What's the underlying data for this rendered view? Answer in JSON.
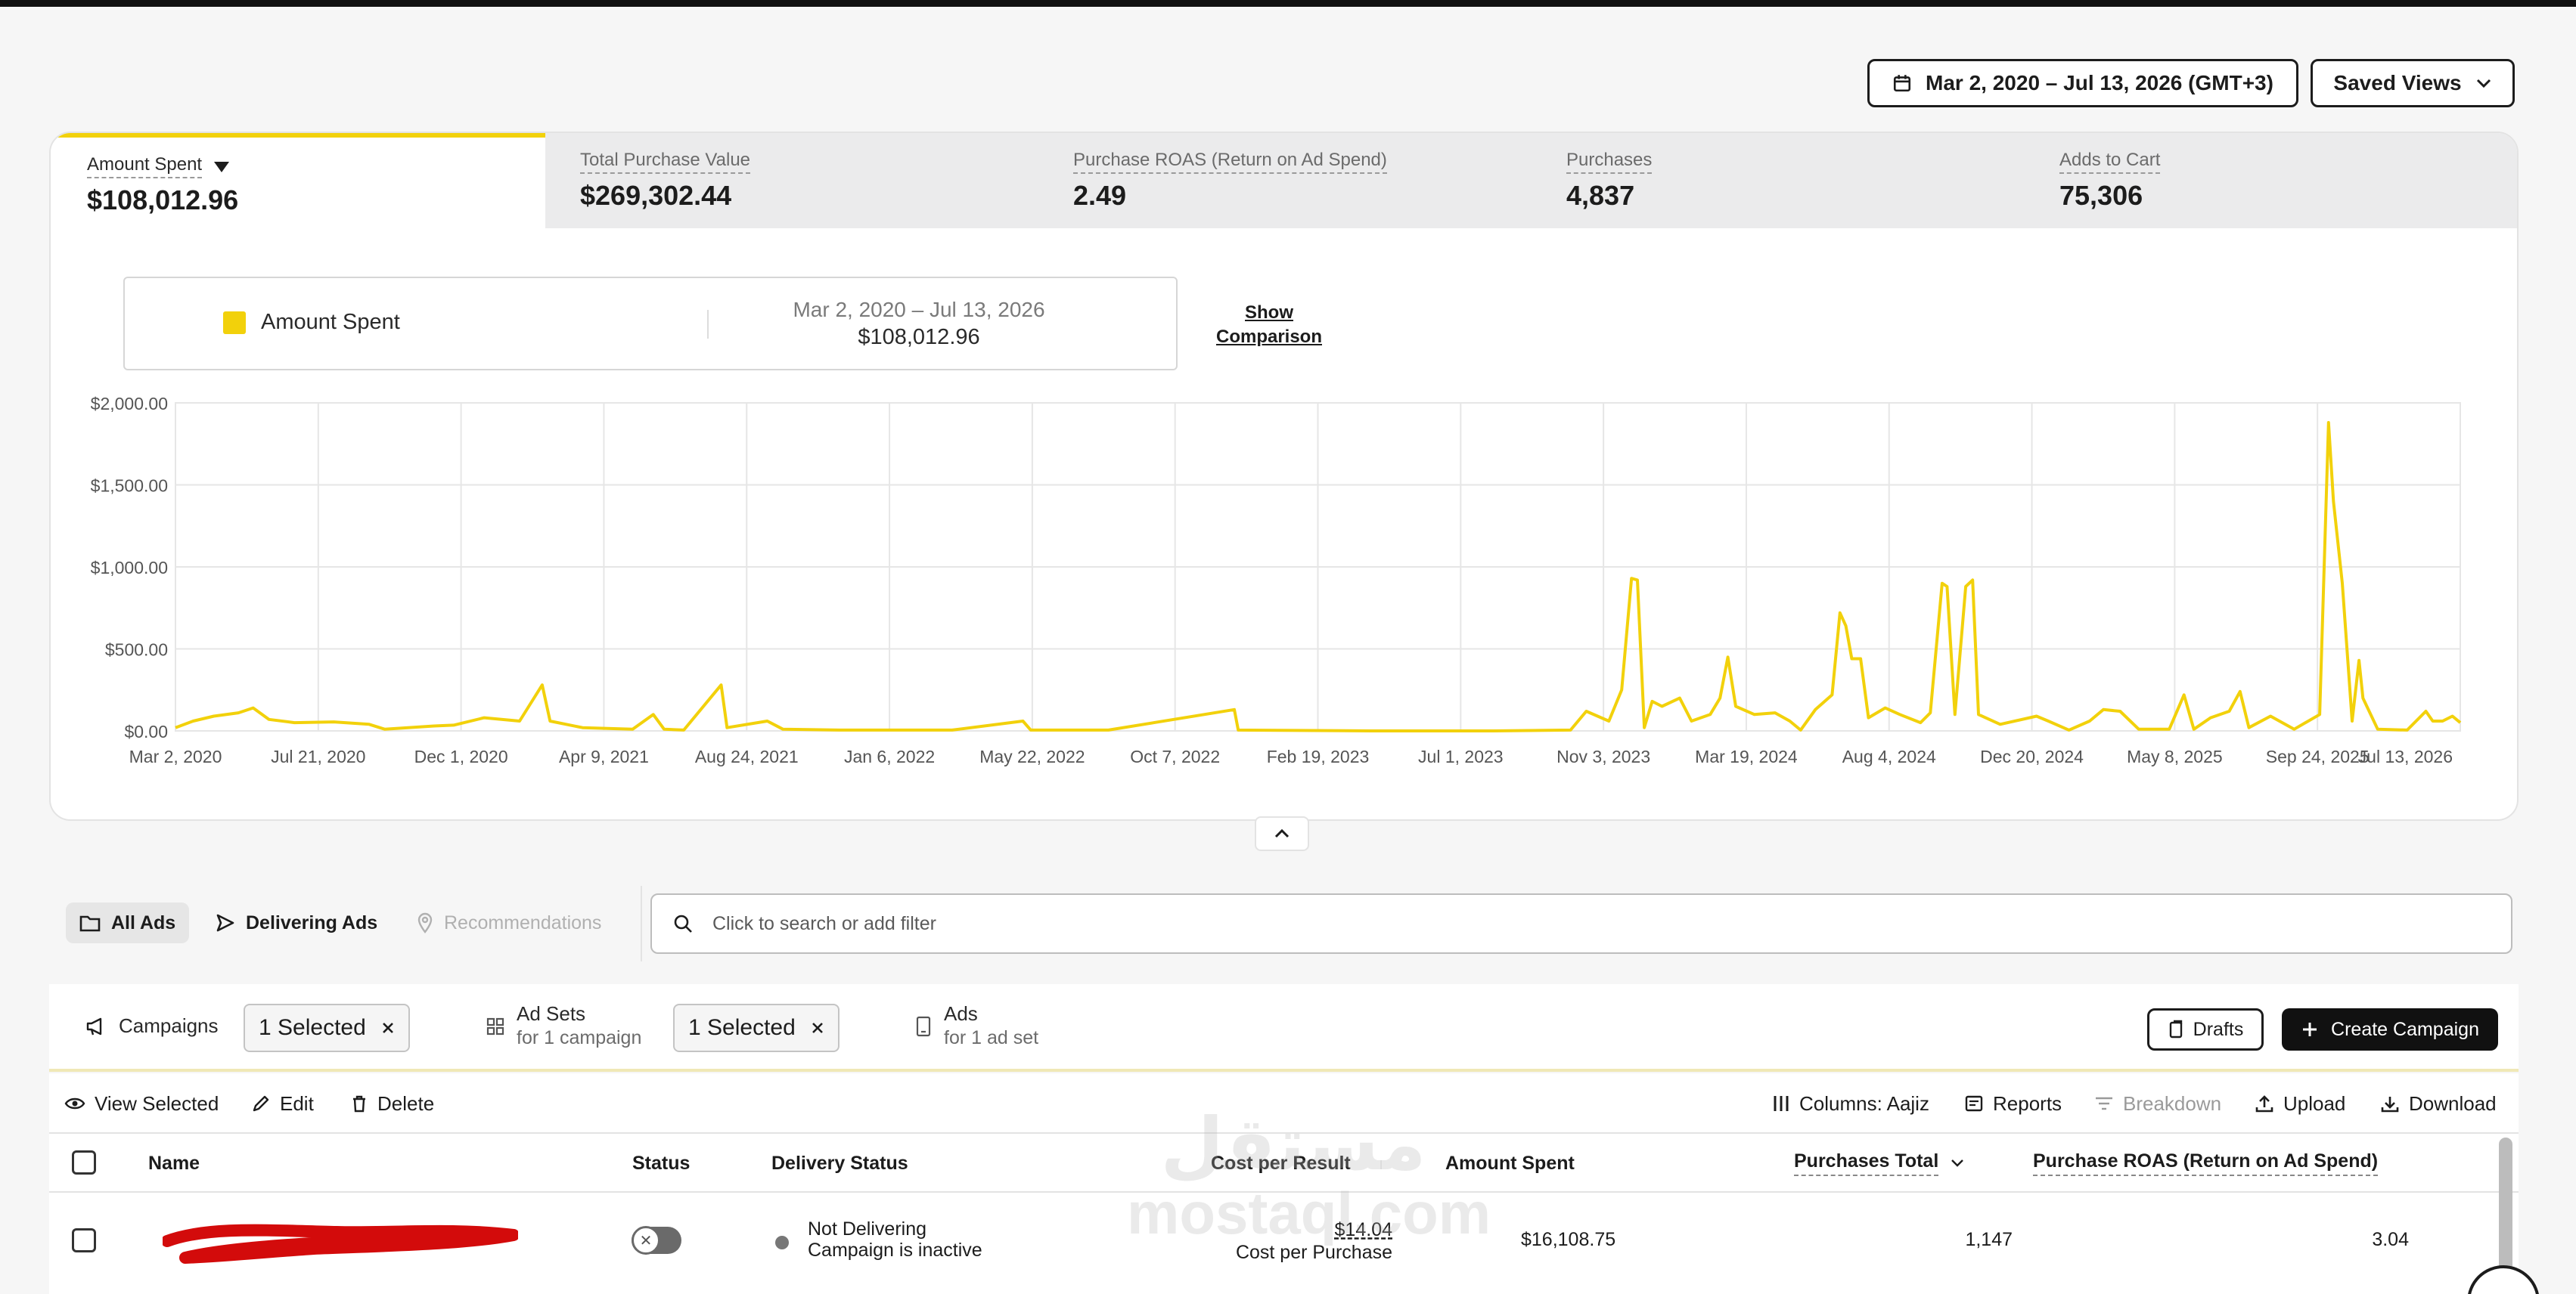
{
  "header": {
    "date_range": "Mar 2, 2020 – Jul 13, 2026 (GMT+3)",
    "saved_views": "Saved Views"
  },
  "metrics": [
    {
      "label": "Amount Spent",
      "value": "$108,012.96",
      "active": true
    },
    {
      "label": "Total Purchase Value",
      "value": "$269,302.44"
    },
    {
      "label": "Purchase ROAS (Return on Ad Spend)",
      "value": "2.49"
    },
    {
      "label": "Purchases",
      "value": "4,837"
    },
    {
      "label": "Adds to Cart",
      "value": "75,306"
    }
  ],
  "legend": {
    "name": "Amount Spent",
    "range": "Mar 2, 2020 – Jul 13, 2026",
    "total": "$108,012.96",
    "show_comparison_1": "Show",
    "show_comparison_2": "Comparison"
  },
  "colors": {
    "accent": "#f2d10b",
    "primary": "#111111"
  },
  "chart_data": {
    "type": "line",
    "series": [
      {
        "name": "Amount Spent"
      }
    ],
    "x_tick_labels": [
      "Mar 2, 2020",
      "Jul 21, 2020",
      "Dec 1, 2020",
      "Apr 9, 2021",
      "Aug 24, 2021",
      "Jan 6, 2022",
      "May 22, 2022",
      "Oct 7, 2022",
      "Feb 19, 2023",
      "Jul 1, 2023",
      "Nov 3, 2023",
      "Mar 19, 2024",
      "Aug 4, 2024",
      "Dec 20, 2024",
      "May 8, 2025",
      "Sep 24, 2025",
      "Jul 13, 2026"
    ],
    "y_tick_labels": [
      "$0.00",
      "$500.00",
      "$1,000.00",
      "$1,500.00",
      "$2,000.00"
    ],
    "ylim": [
      0,
      2000
    ],
    "xlim": [
      "2020-03-02",
      "2026-07-13"
    ],
    "grid": true,
    "points": [
      [
        "2020-03-02",
        20
      ],
      [
        "2020-03-20",
        60
      ],
      [
        "2020-04-10",
        90
      ],
      [
        "2020-05-05",
        110
      ],
      [
        "2020-05-20",
        140
      ],
      [
        "2020-06-05",
        70
      ],
      [
        "2020-07-01",
        50
      ],
      [
        "2020-08-10",
        55
      ],
      [
        "2020-09-15",
        40
      ],
      [
        "2020-10-01",
        10
      ],
      [
        "2020-11-20",
        30
      ],
      [
        "2020-12-10",
        35
      ],
      [
        "2021-01-10",
        80
      ],
      [
        "2021-02-15",
        60
      ],
      [
        "2021-03-10",
        280
      ],
      [
        "2021-03-18",
        60
      ],
      [
        "2021-04-20",
        20
      ],
      [
        "2021-06-10",
        10
      ],
      [
        "2021-07-01",
        100
      ],
      [
        "2021-07-12",
        10
      ],
      [
        "2021-08-01",
        5
      ],
      [
        "2021-09-08",
        280
      ],
      [
        "2021-09-14",
        20
      ],
      [
        "2021-10-25",
        60
      ],
      [
        "2021-11-10",
        10
      ],
      [
        "2022-01-06",
        5
      ],
      [
        "2022-05-01",
        5
      ],
      [
        "2022-07-12",
        60
      ],
      [
        "2022-07-20",
        5
      ],
      [
        "2022-10-07",
        5
      ],
      [
        "2023-02-12",
        130
      ],
      [
        "2023-02-16",
        5
      ],
      [
        "2023-07-01",
        0
      ],
      [
        "2023-11-03",
        0
      ],
      [
        "2024-01-20",
        5
      ],
      [
        "2024-02-05",
        120
      ],
      [
        "2024-02-28",
        60
      ],
      [
        "2024-03-12",
        250
      ],
      [
        "2024-03-22",
        930
      ],
      [
        "2024-03-28",
        920
      ],
      [
        "2024-04-04",
        20
      ],
      [
        "2024-04-12",
        180
      ],
      [
        "2024-04-22",
        150
      ],
      [
        "2024-05-10",
        200
      ],
      [
        "2024-05-22",
        60
      ],
      [
        "2024-06-10",
        100
      ],
      [
        "2024-06-20",
        200
      ],
      [
        "2024-06-28",
        450
      ],
      [
        "2024-07-06",
        150
      ],
      [
        "2024-07-25",
        100
      ],
      [
        "2024-08-15",
        110
      ],
      [
        "2024-08-30",
        60
      ],
      [
        "2024-09-10",
        5
      ],
      [
        "2024-09-25",
        130
      ],
      [
        "2024-10-12",
        220
      ],
      [
        "2024-10-20",
        720
      ],
      [
        "2024-10-26",
        640
      ],
      [
        "2024-11-01",
        440
      ],
      [
        "2024-11-10",
        440
      ],
      [
        "2024-11-18",
        80
      ],
      [
        "2024-12-05",
        140
      ],
      [
        "2024-12-20",
        100
      ],
      [
        "2025-01-10",
        50
      ],
      [
        "2025-01-20",
        110
      ],
      [
        "2025-02-01",
        900
      ],
      [
        "2025-02-06",
        880
      ],
      [
        "2025-02-14",
        100
      ],
      [
        "2025-02-25",
        880
      ],
      [
        "2025-03-04",
        920
      ],
      [
        "2025-03-10",
        100
      ],
      [
        "2025-04-01",
        40
      ],
      [
        "2025-05-08",
        90
      ],
      [
        "2025-05-20",
        60
      ],
      [
        "2025-06-10",
        5
      ],
      [
        "2025-07-01",
        60
      ],
      [
        "2025-07-15",
        130
      ],
      [
        "2025-08-01",
        120
      ],
      [
        "2025-08-20",
        10
      ],
      [
        "2025-09-20",
        10
      ],
      [
        "2025-10-05",
        220
      ],
      [
        "2025-10-15",
        10
      ],
      [
        "2025-11-01",
        80
      ],
      [
        "2025-11-20",
        120
      ],
      [
        "2025-12-01",
        240
      ],
      [
        "2025-12-10",
        20
      ],
      [
        "2026-01-01",
        90
      ],
      [
        "2026-01-25",
        10
      ],
      [
        "2026-02-20",
        100
      ],
      [
        "2026-03-01",
        1880
      ],
      [
        "2026-03-06",
        1400
      ],
      [
        "2026-03-15",
        900
      ],
      [
        "2026-03-25",
        60
      ],
      [
        "2026-04-01",
        430
      ],
      [
        "2026-04-05",
        200
      ],
      [
        "2026-04-20",
        10
      ],
      [
        "2026-05-20",
        5
      ],
      [
        "2026-06-08",
        120
      ],
      [
        "2026-06-15",
        60
      ],
      [
        "2026-06-25",
        60
      ],
      [
        "2026-07-05",
        90
      ],
      [
        "2026-07-13",
        50
      ]
    ]
  },
  "filters": {
    "all_ads": "All Ads",
    "delivering_ads": "Delivering Ads",
    "recommendations": "Recommendations",
    "search_placeholder": "Click to search or add filter"
  },
  "levels": {
    "campaigns": "Campaigns",
    "campaigns_selected": "1 Selected",
    "ad_sets": "Ad Sets",
    "ad_sets_sub": "for 1 campaign",
    "ad_sets_selected": "1 Selected",
    "ads": "Ads",
    "ads_sub": "for 1 ad set",
    "drafts": "Drafts",
    "create_campaign": "Create Campaign"
  },
  "actions": {
    "view_selected": "View Selected",
    "edit": "Edit",
    "delete": "Delete",
    "columns": "Columns: Aajiz",
    "reports": "Reports",
    "breakdown": "Breakdown",
    "upload": "Upload",
    "download": "Download"
  },
  "table": {
    "headers": {
      "name": "Name",
      "status": "Status",
      "delivery_status": "Delivery Status",
      "cost_per_result": "Cost per Result",
      "amount_spent": "Amount Spent",
      "purchases_total": "Purchases Total",
      "purchase_roas": "Purchase ROAS (Return on Ad Spend)"
    },
    "rows": [
      {
        "delivery_line1": "Not Delivering",
        "delivery_line2": "Campaign is inactive",
        "cost_per_result": "$14.04",
        "cost_per_result_sub": "Cost per Purchase",
        "amount_spent": "$16,108.75",
        "purchases_total": "1,147",
        "purchase_roas": "3.04"
      }
    ]
  },
  "watermark": {
    "line1": "مستقل",
    "line2": "mostaql.com"
  }
}
